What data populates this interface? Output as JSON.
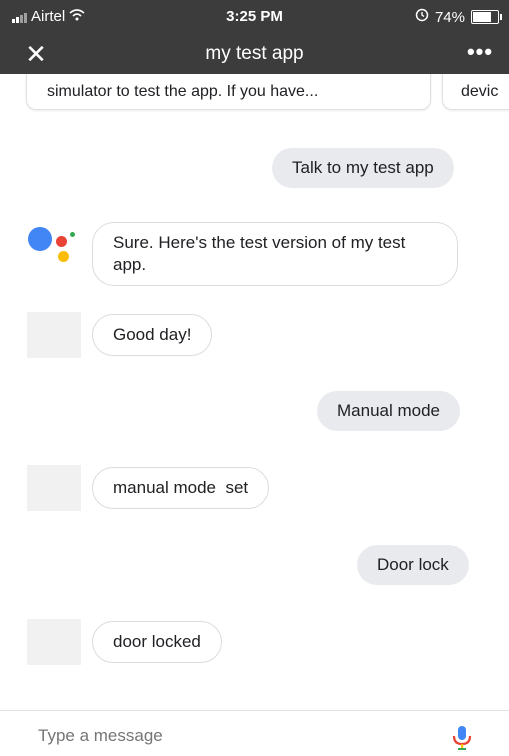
{
  "status_bar": {
    "carrier": "Airtel",
    "time": "3:25 PM",
    "battery_percent": "74%",
    "battery_level": 0.74
  },
  "app": {
    "title": "my test app"
  },
  "cards": [
    {
      "text": "simulator to test the app. If you have..."
    },
    {
      "text": "devic"
    }
  ],
  "messages": [
    {
      "sender": "user",
      "text": "Talk to my test app"
    },
    {
      "sender": "assistant",
      "text": "Sure. Here's the test version of my test app."
    },
    {
      "sender": "bot",
      "text": "Good day!"
    },
    {
      "sender": "user",
      "text": "Manual mode"
    },
    {
      "sender": "bot",
      "text": "manual mode  set"
    },
    {
      "sender": "user",
      "text": "Door lock"
    },
    {
      "sender": "bot",
      "text": "door locked"
    }
  ],
  "input": {
    "placeholder": "Type a message"
  },
  "colors": {
    "header": "#3c3c3c",
    "user_bubble": "#e8eaed",
    "google_blue": "#4285f4",
    "google_red": "#ea4335",
    "google_yellow": "#fbbc05",
    "google_green": "#34a853"
  },
  "icons": [
    "close-icon",
    "more-options-icon",
    "mic-icon",
    "wifi-icon",
    "signal-icon",
    "battery-icon",
    "alarm-icon"
  ]
}
